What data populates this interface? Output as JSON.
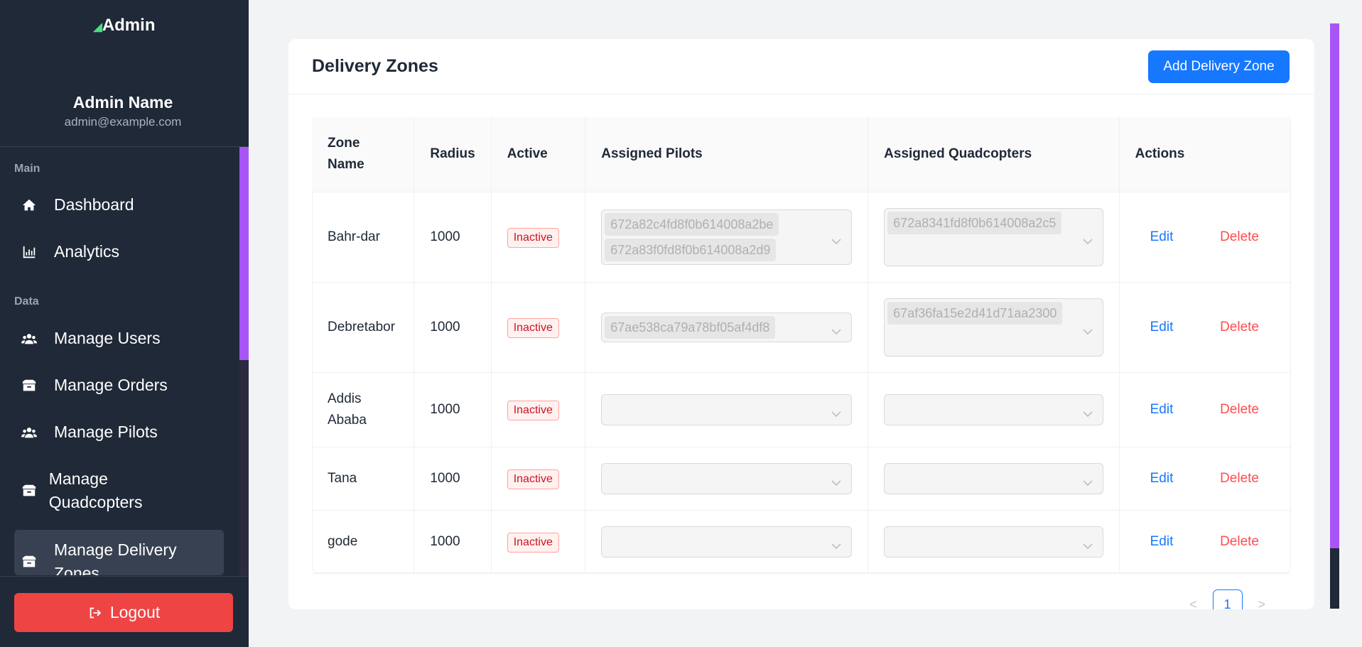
{
  "sidebar": {
    "logo": "Admin",
    "admin_name": "Admin Name",
    "admin_email": "admin@example.com",
    "sections": [
      {
        "label": "Main"
      },
      {
        "label": "Data"
      }
    ],
    "items": [
      {
        "label": "Dashboard",
        "icon": "home-icon"
      },
      {
        "label": "Analytics",
        "icon": "chart-icon"
      },
      {
        "label": "Manage Users",
        "icon": "users-icon"
      },
      {
        "label": "Manage Orders",
        "icon": "box-icon"
      },
      {
        "label": "Manage Pilots",
        "icon": "users-icon"
      },
      {
        "label": "Manage Quadcopters",
        "icon": "box-icon"
      },
      {
        "label": "Manage Delivery Zones",
        "icon": "box-icon"
      }
    ],
    "logout_label": "Logout"
  },
  "main": {
    "title": "Delivery Zones",
    "add_button": "Add Delivery Zone",
    "columns": [
      "Zone Name",
      "Radius",
      "Active",
      "Assigned Pilots",
      "Assigned Quadcopters",
      "Actions"
    ],
    "rows": [
      {
        "zone": "Bahr-dar",
        "radius": "1000",
        "active": "Inactive",
        "pilots": [
          "672a82c4fd8f0b614008a2be",
          "672a83f0fd8f0b614008a2d9"
        ],
        "quadcopters": [
          "672a8341fd8f0b614008a2c5"
        ],
        "edit": "Edit",
        "delete": "Delete"
      },
      {
        "zone": "Debretabor",
        "radius": "1000",
        "active": "Inactive",
        "pilots": [
          "67ae538ca79a78bf05af4df8"
        ],
        "quadcopters": [
          "67af36fa15e2d41d71aa2300"
        ],
        "edit": "Edit",
        "delete": "Delete"
      },
      {
        "zone": "Addis Ababa",
        "radius": "1000",
        "active": "Inactive",
        "pilots": [],
        "quadcopters": [],
        "edit": "Edit",
        "delete": "Delete"
      },
      {
        "zone": "Tana",
        "radius": "1000",
        "active": "Inactive",
        "pilots": [],
        "quadcopters": [],
        "edit": "Edit",
        "delete": "Delete"
      },
      {
        "zone": "gode",
        "radius": "1000",
        "active": "Inactive",
        "pilots": [],
        "quadcopters": [],
        "edit": "Edit",
        "delete": "Delete"
      }
    ],
    "pagination": {
      "prev": "<",
      "current": "1",
      "next": ">"
    }
  },
  "colors": {
    "accent": "#1677ff",
    "danger": "#ef4444",
    "sidebar": "#1f2937",
    "scrollbar": "#a855f7"
  }
}
